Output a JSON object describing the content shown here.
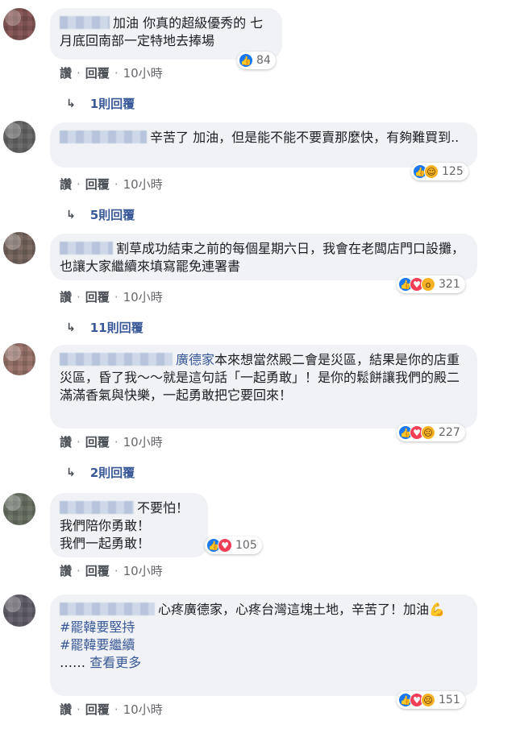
{
  "actions": {
    "like": "讚",
    "reply": "回覆",
    "dot": "·"
  },
  "comments": [
    {
      "text": "加油 你真的超級優秀的 七月底回南部一定特地去捧場",
      "reactions": [
        "like"
      ],
      "count": "84",
      "time": "10小時",
      "replies": "1則回覆"
    },
    {
      "text": "辛苦了 加油，但是能不能不要賣那麼快，有夠難買到..",
      "reactions": [
        "like",
        "haha"
      ],
      "count": "125",
      "time": "10小時",
      "replies": "5則回覆"
    },
    {
      "text": "割草成功結束之前的每個星期六日，我會在老闆店門口設攤，也讓大家繼續來填寫罷免連署書",
      "reactions": [
        "like",
        "love",
        "wow"
      ],
      "count": "321",
      "time": "10小時",
      "replies": "11則回覆"
    },
    {
      "mention": "廣德家",
      "text": "本來想當然殿二會是災區，結果是你的店重災區，昏了我～～就是這句話「一起勇敢」！是你的鬆餅讓我們的殿二滿滿香氣與快樂，一起勇敢把它要回來！",
      "reactions": [
        "like",
        "love",
        "sad"
      ],
      "count": "227",
      "time": "10小時",
      "replies": "2則回覆"
    },
    {
      "lines": [
        "不要怕！",
        "我們陪你勇敢！",
        "我們一起勇敢！"
      ],
      "reactions": [
        "like",
        "love"
      ],
      "count": "105",
      "time": "10小時"
    },
    {
      "text": "心疼廣德家，心疼台灣這塊土地，辛苦了！加油💪",
      "hashtags": [
        "#罷韓要堅持",
        "#罷韓要繼續"
      ],
      "seemore_dots": "……",
      "seemore": "查看更多",
      "reactions": [
        "like",
        "love",
        "sad"
      ],
      "count": "151",
      "time": "10小時"
    }
  ],
  "icons": {
    "like": "thumbs-up",
    "love": "heart",
    "haha": "laugh",
    "wow": "wow",
    "sad": "sad",
    "reply_arrow": "reply-arrow"
  },
  "colors": {
    "link": "#385898",
    "bubble": "#f0f2f5",
    "like": "#1877f2",
    "love": "#f33e58",
    "emoji": "#f7b125"
  }
}
